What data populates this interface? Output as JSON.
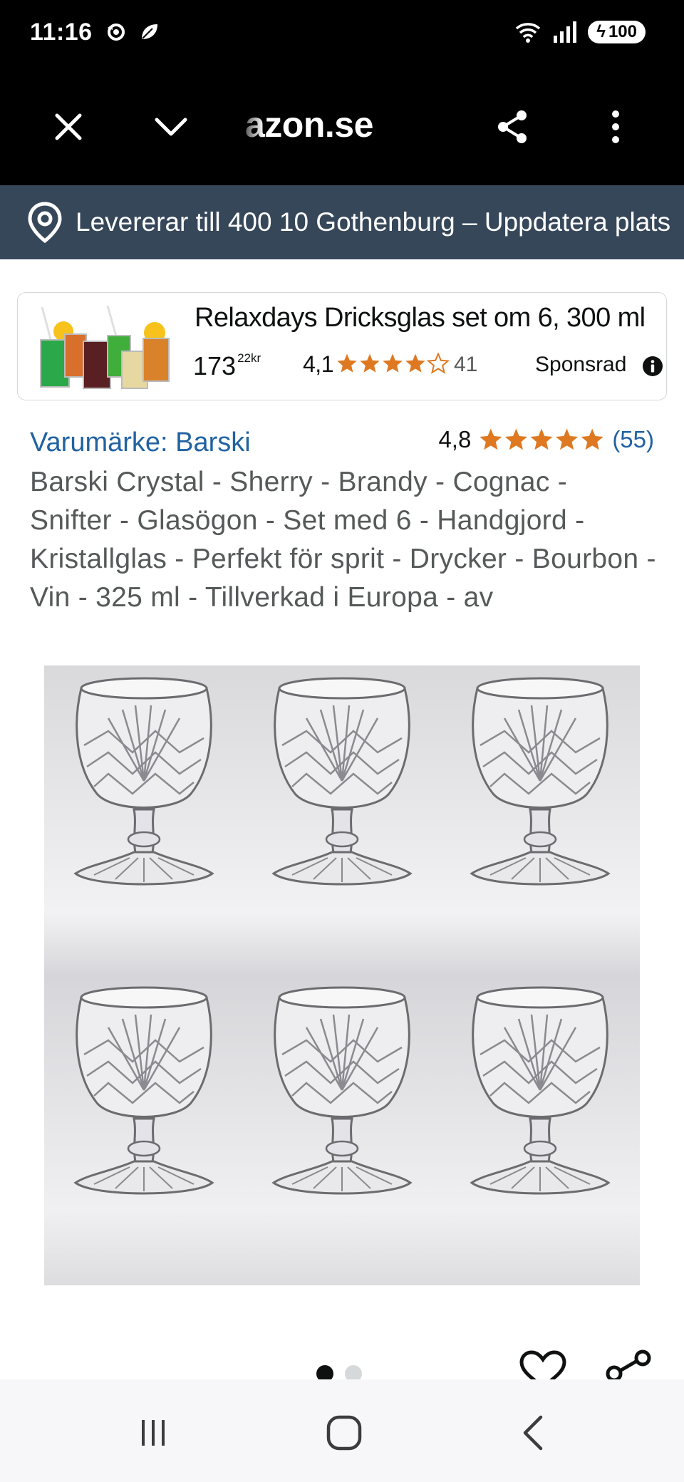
{
  "status_bar": {
    "time": "11:16",
    "battery": "100"
  },
  "browser": {
    "url": "azon.se"
  },
  "delivery": {
    "text": "Levererar till 400 10 Gothenburg – Uppdatera plats"
  },
  "sponsored": {
    "title": "Relaxdays Dricksglas set om 6, 300 ml",
    "price_whole": "173",
    "price_fraction": "22",
    "price_currency": "kr",
    "rating": "4,1",
    "stars": 4.1,
    "review_count": "41",
    "label": "Sponsrad"
  },
  "product": {
    "brand": "Varumärke: Barski",
    "rating": "4,8",
    "stars": 4.8,
    "review_count": "(55)",
    "title": "Barski Crystal - Sherry - Brandy - Cognac - Snifter - Glasögon - Set med 6 - Handgjord - Kristallglas - Perfekt för sprit - Drycker - Bourbon - Vin - 325 ml - Tillverkad i Europa - av"
  },
  "gallery": {
    "current_image": 1,
    "total_images": 2
  },
  "colors": {
    "star": "#de7921",
    "link": "#2162a1",
    "delivery_bg": "#37475a"
  }
}
